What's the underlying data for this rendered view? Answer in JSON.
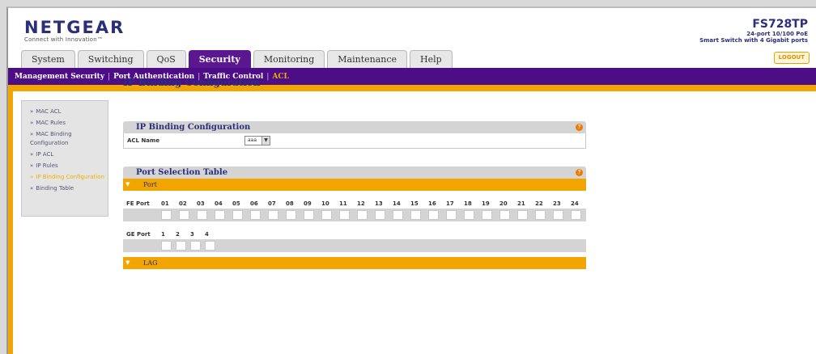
{
  "brand": {
    "logo": "NETGEAR",
    "tagline": "Connect with Innovation™"
  },
  "device": {
    "model": "FS728TP",
    "desc1": "24-port 10/100 PoE",
    "desc2": "Smart Switch with 4 Gigabit ports"
  },
  "tabs": [
    {
      "label": "System"
    },
    {
      "label": "Switching"
    },
    {
      "label": "QoS"
    },
    {
      "label": "Security",
      "active": true
    },
    {
      "label": "Monitoring"
    },
    {
      "label": "Maintenance"
    },
    {
      "label": "Help"
    }
  ],
  "logout_label": "LOGOUT",
  "subnav": [
    {
      "label": "Management Security"
    },
    {
      "label": "Port Authentication"
    },
    {
      "label": "Traffic Control"
    },
    {
      "label": "ACL",
      "current": true
    }
  ],
  "sidebar": [
    {
      "label": "MAC ACL"
    },
    {
      "label": "MAC Rules"
    },
    {
      "label": "MAC Binding Configuration"
    },
    {
      "label": "IP ACL"
    },
    {
      "label": "IP Rules"
    },
    {
      "label": "IP Binding Configuration",
      "current": true
    },
    {
      "label": "Binding Table"
    }
  ],
  "page_title": "IP Binding Configuration",
  "config_panel": {
    "title": "IP Binding Configuration",
    "acl_label": "ACL Name",
    "acl_value": "aaa"
  },
  "port_panel": {
    "title": "Port Selection Table",
    "port_label": "Port",
    "fe_label": "FE Port",
    "fe_ports": [
      "01",
      "02",
      "03",
      "04",
      "05",
      "06",
      "07",
      "08",
      "09",
      "10",
      "11",
      "12",
      "13",
      "14",
      "15",
      "16",
      "17",
      "18",
      "19",
      "20",
      "21",
      "22",
      "23",
      "24"
    ],
    "ge_label": "GE Port",
    "ge_ports": [
      "1",
      "2",
      "3",
      "4"
    ],
    "lag_label": "LAG"
  },
  "colors": {
    "brand_purple": "#4c0d86",
    "accent_orange": "#f2a400",
    "header_text": "#2c2e7a"
  }
}
